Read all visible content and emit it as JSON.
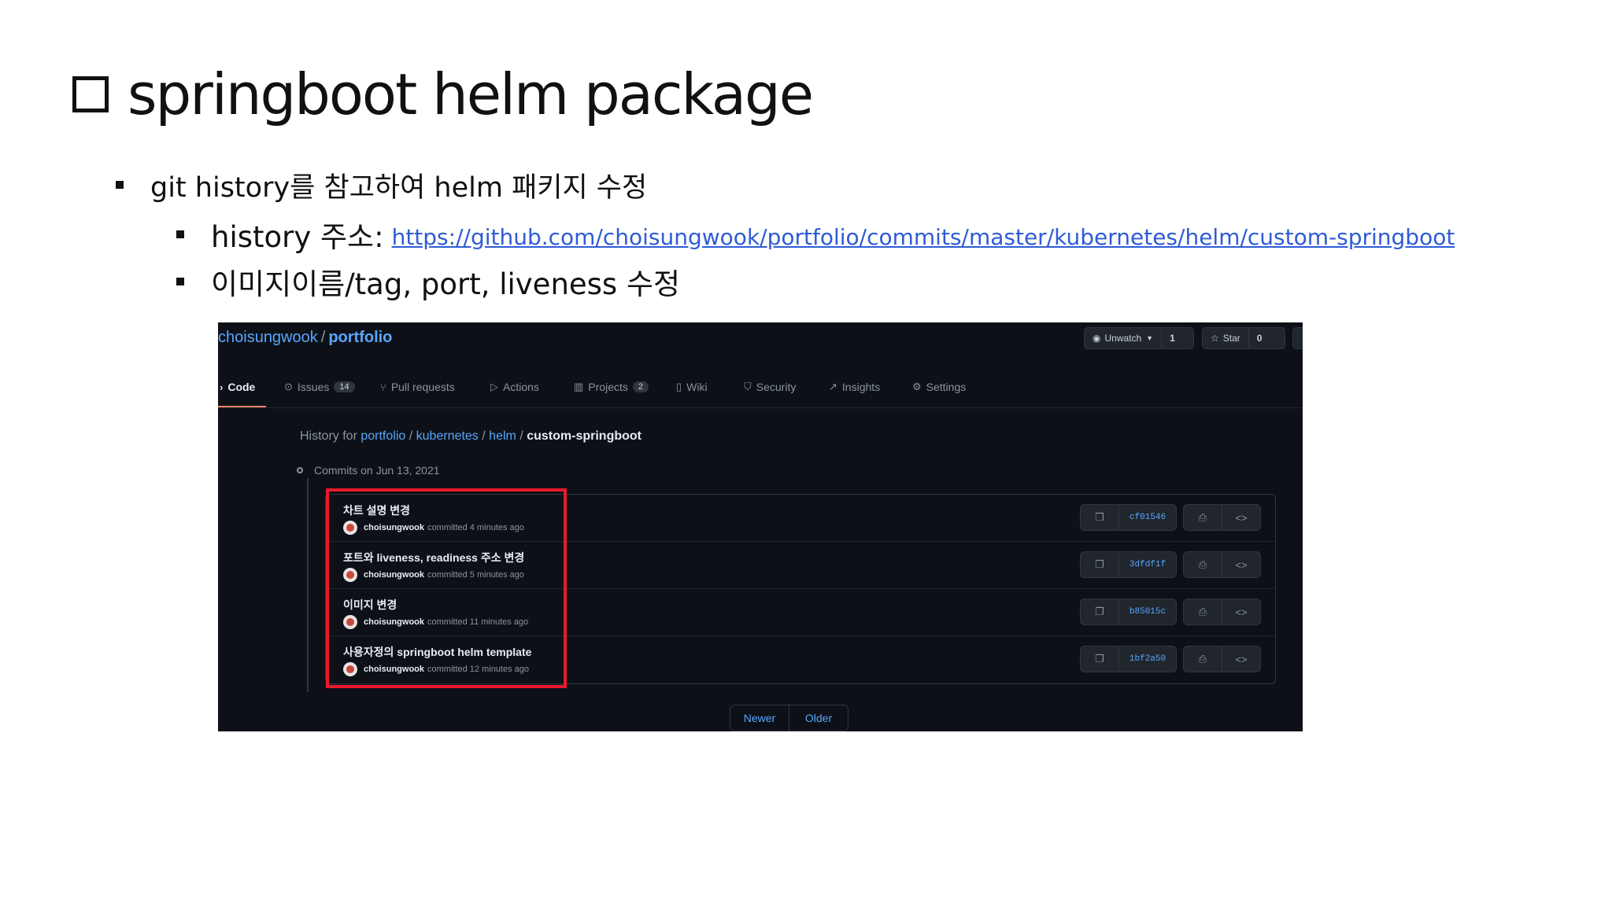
{
  "slide": {
    "title": "springboot helm package",
    "bullet1": "git history를 참고하여 helm 패키지 수정",
    "bullet2_label": "history 주소:",
    "bullet2_link": "https://github.com/choisungwook/portfolio/commits/master/kubernetes/helm/custom-springboot",
    "bullet3": "이미지이름/tag, port, liveness 수정"
  },
  "github": {
    "owner": "choisungwook",
    "separator": "/",
    "repo": "portfolio",
    "unwatch_label": "Unwatch",
    "unwatch_count": "1",
    "star_label": "Star",
    "star_count": "0",
    "tabs": [
      {
        "label": "Code",
        "icon": "code-icon"
      },
      {
        "label": "Issues",
        "icon": "issue-icon",
        "count": "14"
      },
      {
        "label": "Pull requests",
        "icon": "pull-request-icon"
      },
      {
        "label": "Actions",
        "icon": "play-icon"
      },
      {
        "label": "Projects",
        "icon": "project-icon",
        "count": "2"
      },
      {
        "label": "Wiki",
        "icon": "book-icon"
      },
      {
        "label": "Security",
        "icon": "shield-icon"
      },
      {
        "label": "Insights",
        "icon": "graph-icon"
      },
      {
        "label": "Settings",
        "icon": "gear-icon"
      }
    ],
    "history": {
      "prefix": "History for",
      "path": [
        "portfolio",
        "kubernetes",
        "helm"
      ],
      "current": "custom-springboot"
    },
    "commits_date": "Commits on Jun 13, 2021",
    "commits": [
      {
        "message": "차트 설명 변경",
        "user": "choisungwook",
        "time": "committed 4 minutes ago",
        "sha": "cf01546"
      },
      {
        "message": "포트와 liveness, readiness 주소 변경",
        "user": "choisungwook",
        "time": "committed 5 minutes ago",
        "sha": "3dfdf1f"
      },
      {
        "message": "이미지 변경",
        "user": "choisungwook",
        "time": "committed 11 minutes ago",
        "sha": "b85015c"
      },
      {
        "message": "사용자정의 springboot helm template",
        "user": "choisungwook",
        "time": "committed 12 minutes ago",
        "sha": "1bf2a50"
      }
    ],
    "pager": {
      "newer": "Newer",
      "older": "Older"
    },
    "highlight_color": "#e8192c"
  }
}
